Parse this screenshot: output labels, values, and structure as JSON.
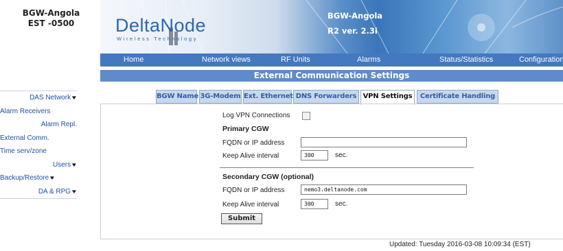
{
  "site": {
    "name": "BGW-Angola",
    "timezone": "EST -0500"
  },
  "left_nav": [
    {
      "label": "DAS Network",
      "has_dropdown": true
    },
    {
      "label": "Alarm Receivers",
      "has_dropdown": false
    },
    {
      "label": "Alarm Repl.",
      "has_dropdown": false
    },
    {
      "label": "External Comm.",
      "has_dropdown": false
    },
    {
      "label": "Time serv/zone",
      "has_dropdown": false
    },
    {
      "label": "Users",
      "has_dropdown": true
    },
    {
      "label": "Backup/Restore",
      "has_dropdown": true
    },
    {
      "label": "DA & RPG",
      "has_dropdown": true
    }
  ],
  "banner": {
    "logo": "DeltaNode",
    "logo_sub": "Wireless Technology",
    "title": "BGW-Angola",
    "version": "R2 ver. 2.3i"
  },
  "top_menu": [
    "Home",
    "Network views",
    "RF Units",
    "Alarms",
    "Status/Statistics",
    "Configuration"
  ],
  "section_title": "External Communication Settings",
  "tabs": [
    {
      "label": "BGW Name",
      "active": false
    },
    {
      "label": "3G-Modem",
      "active": false
    },
    {
      "label": "Ext. Ethernet",
      "active": false
    },
    {
      "label": "DNS Forwarders",
      "active": false
    },
    {
      "label": "VPN Settings",
      "active": true
    },
    {
      "label": "Certificate Handling",
      "active": false
    }
  ],
  "form": {
    "log_vpn_label": "Log VPN Connections",
    "log_vpn_checked": false,
    "primary": {
      "heading": "Primary CGW",
      "fqdn_label": "FQDN or IP address",
      "fqdn_value": "",
      "keepalive_label": "Keep Alive interval",
      "keepalive_value": "300",
      "unit": "sec."
    },
    "secondary": {
      "heading": "Secondary CGW (optional)",
      "fqdn_label": "FQDN or IP address",
      "fqdn_value": "nemo3.deltanode.com",
      "keepalive_label": "Keep Alive interval",
      "keepalive_value": "300",
      "unit": "sec."
    },
    "submit_label": "Submit"
  },
  "footer": {
    "updated": "Updated: Tuesday 2016-03-08 10:09:34 (EST)"
  },
  "colors": {
    "menu_bar": "#4478c0",
    "section_header": "#5d8cc9",
    "tab_bg": "#c8d8ec",
    "link": "#1f4fa0"
  }
}
